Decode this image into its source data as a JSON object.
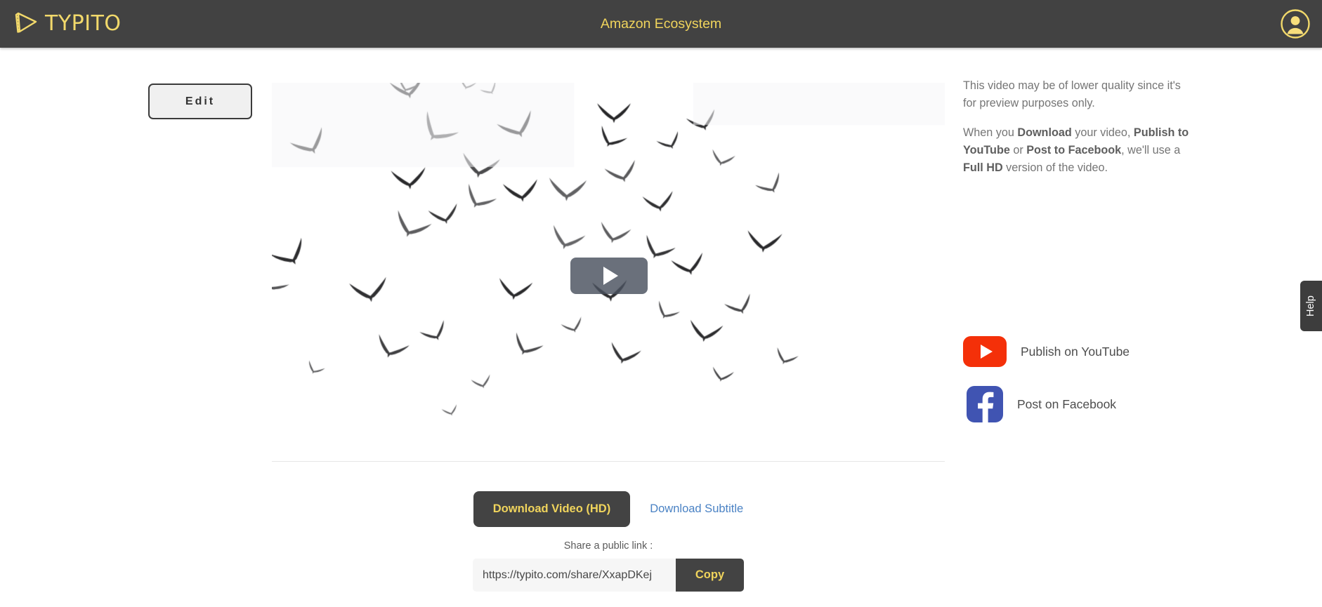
{
  "header": {
    "brand": "TYPITO",
    "brand_icon": "typito-film-play-icon",
    "project_title": "Amazon Ecosystem",
    "avatar_icon": "user-avatar-icon",
    "bg_color": "#424242",
    "accent_color": "#F0D45C"
  },
  "toolbar": {
    "edit_label": "Edit"
  },
  "video": {
    "play_icon": "play-triangle-icon",
    "is_playing": false
  },
  "actions": {
    "download_video_label": "Download Video (HD)",
    "download_subtitle_label": "Download Subtitle",
    "download_subtitle_color": "#4a82c4",
    "download_button_bg": "#434343"
  },
  "share": {
    "label": "Share a public link :",
    "url": "https://typito.com/share/XxapDKej",
    "placeholder": "https://typito.com/share/",
    "copy_label": "Copy"
  },
  "notice": {
    "paragraph_1": "This video may be of lower quality since it's for preview purposes only.",
    "p2_part1": "When you ",
    "p2_bold1": "Download",
    "p2_part2": " your video, ",
    "p2_bold2": "Publish to YouTube",
    "p2_part3": " or ",
    "p2_bold3": "Post to Facebook",
    "p2_part4": ", we'll use a ",
    "p2_bold4": "Full HD",
    "p2_part5": " version of the video."
  },
  "social": {
    "youtube_label": "Publish on YouTube",
    "youtube_icon": "youtube-icon",
    "youtube_color": "#F43009",
    "facebook_label": "Post on Facebook",
    "facebook_icon": "facebook-icon",
    "facebook_color": "#4054B2"
  },
  "help": {
    "label": "Help"
  }
}
